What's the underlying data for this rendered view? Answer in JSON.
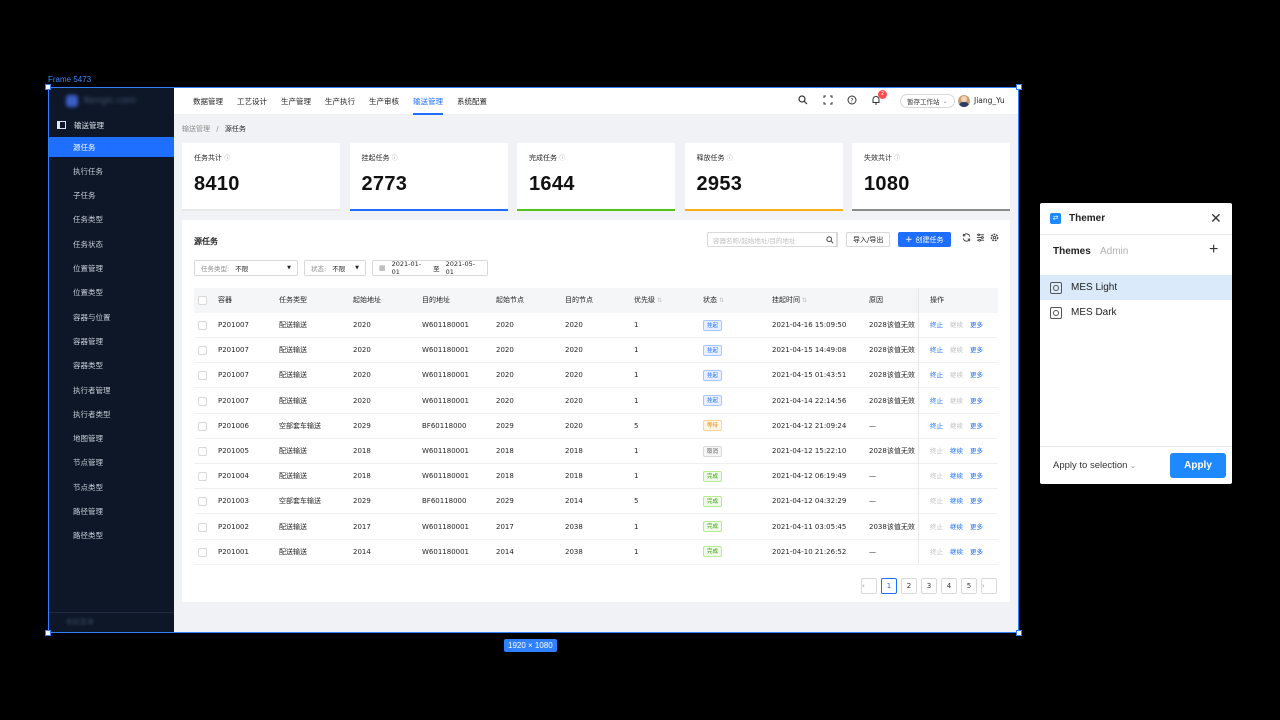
{
  "canvas": {
    "frame_label": "Frame 5473",
    "size_badge": "1920 × 1080"
  },
  "sidebar": {
    "logo": "Kengic.com",
    "group": "输送管理",
    "items": [
      "源任务",
      "执行任务",
      "子任务",
      "任务类型",
      "任务状态",
      "位置管理",
      "位置类型",
      "容器与位置",
      "容器管理",
      "容器类型",
      "执行者管理",
      "执行者类型",
      "地图管理",
      "节点管理",
      "节点类型",
      "路径管理",
      "路径类型"
    ],
    "active_index": 0,
    "footer": "收起菜单"
  },
  "topnav": {
    "items": [
      "数据管理",
      "工艺设计",
      "生产管理",
      "生产执行",
      "生产审核",
      "输送管理",
      "系统配置"
    ],
    "active_index": 5,
    "notif_count": "2",
    "station": "暂存工作站",
    "user": "Jiang_Yu"
  },
  "breadcrumb": {
    "parent": "输送管理",
    "sep": "/",
    "current": "源任务"
  },
  "stats": [
    {
      "label": "任务共计",
      "value": "8410",
      "color": "#e8e8e8"
    },
    {
      "label": "挂起任务",
      "value": "2773",
      "color": "#1e6fff"
    },
    {
      "label": "完成任务",
      "value": "1644",
      "color": "#52c41a"
    },
    {
      "label": "释放任务",
      "value": "2953",
      "color": "#faad14"
    },
    {
      "label": "失效共计",
      "value": "1080",
      "color": "#8c8c8c"
    }
  ],
  "panel": {
    "title": "源任务",
    "search_placeholder": "容器名称/起始地址/目的地址",
    "import_export": "导入/导出",
    "create": "创建任务",
    "filters": {
      "type_label": "任务类型:",
      "type_value": "不限",
      "status_label": "状态:",
      "status_value": "不限",
      "date_from": "2021-01-01",
      "date_to_sep": "至",
      "date_to": "2021-05-01"
    }
  },
  "table": {
    "headers": [
      "容器",
      "任务类型",
      "起始地址",
      "目的地址",
      "起始节点",
      "目的节点",
      "优先级",
      "状态",
      "挂起时间",
      "原因",
      "操作"
    ],
    "rows": [
      [
        "P201007",
        "配送输送",
        "2020",
        "W601180001",
        "2020",
        "2020",
        "1",
        "挂起",
        "2021-04-16 15:09:50",
        "2028该值无效"
      ],
      [
        "P201007",
        "配送输送",
        "2020",
        "W601180001",
        "2020",
        "2020",
        "1",
        "挂起",
        "2021-04-15 14:49:08",
        "2028该值无效"
      ],
      [
        "P201007",
        "配送输送",
        "2020",
        "W601180001",
        "2020",
        "2020",
        "1",
        "挂起",
        "2021-04-15 01:43:51",
        "2028该值无效"
      ],
      [
        "P201007",
        "配送输送",
        "2020",
        "W601180001",
        "2020",
        "2020",
        "1",
        "挂起",
        "2021-04-14 22:14:56",
        "2028该值无效"
      ],
      [
        "P201006",
        "空部套车输送",
        "2029",
        "BF60118000",
        "2029",
        "2020",
        "5",
        "等待",
        "2021-04-12 21:09:24",
        "—"
      ],
      [
        "P201005",
        "配送输送",
        "2018",
        "W601180001",
        "2018",
        "2018",
        "1",
        "取消",
        "2021-04-12 15:22:10",
        "2028该值无效"
      ],
      [
        "P201004",
        "配送输送",
        "2018",
        "W601180001",
        "2018",
        "2018",
        "1",
        "完成",
        "2021-04-12 06:19:49",
        "—"
      ],
      [
        "P201003",
        "空部套车输送",
        "2029",
        "BF60118000",
        "2029",
        "2014",
        "5",
        "完成",
        "2021-04-12 04:32:29",
        "—"
      ],
      [
        "P201002",
        "配送输送",
        "2017",
        "W601180001",
        "2017",
        "2038",
        "1",
        "完成",
        "2021-04-11 03:05:45",
        "2038该值无效"
      ],
      [
        "P201001",
        "配送输送",
        "2014",
        "W601180001",
        "2014",
        "2038",
        "1",
        "完成",
        "2021-04-10 21:26:52",
        "—"
      ]
    ],
    "status_colors": {
      "挂起": "blue",
      "等待": "orange",
      "取消": "gray",
      "完成": "green"
    },
    "ops": [
      "终止",
      "继续",
      "更多"
    ],
    "ops_state": [
      [
        true,
        false,
        true
      ],
      [
        true,
        false,
        true
      ],
      [
        true,
        false,
        true
      ],
      [
        true,
        false,
        true
      ],
      [
        true,
        false,
        true
      ],
      [
        false,
        true,
        true
      ],
      [
        false,
        true,
        true
      ],
      [
        false,
        true,
        true
      ],
      [
        false,
        true,
        true
      ],
      [
        false,
        true,
        true
      ]
    ]
  },
  "pager": {
    "prev": "‹",
    "pages": [
      "1",
      "2",
      "3",
      "4",
      "5"
    ],
    "active": "1",
    "next": "›"
  },
  "themer": {
    "title": "Themer",
    "tabs": [
      "Themes",
      "Admin"
    ],
    "themes": [
      "MES Light",
      "MES Dark"
    ],
    "selected_index": 0,
    "apply_to": "Apply to selection",
    "apply": "Apply"
  }
}
